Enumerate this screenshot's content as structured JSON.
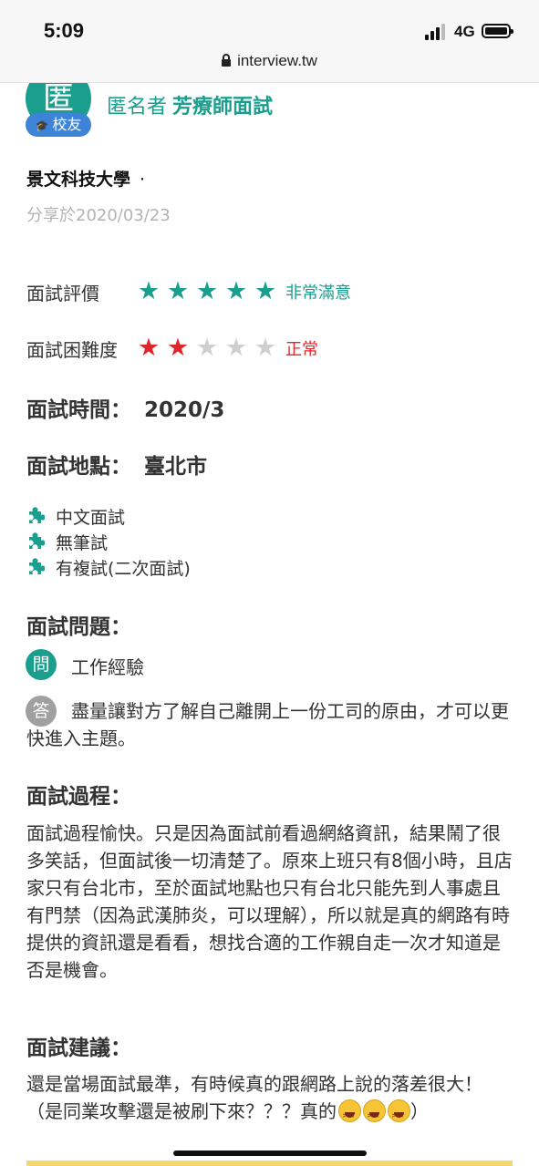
{
  "status_bar": {
    "time": "5:09",
    "network": "4G",
    "url": "interview.tw"
  },
  "author": {
    "avatar_char": "匿",
    "badge": "校友",
    "name": "匿名者",
    "job_title": "芳療師面試",
    "school": "景文科技大學",
    "school_separator": "·",
    "shared_on": "分享於2020/03/23"
  },
  "ratings": {
    "evaluation": {
      "label": "面試評價",
      "stars": 5,
      "max": 5,
      "text": "非常滿意",
      "color": "#1a9e8d"
    },
    "difficulty": {
      "label": "面試困難度",
      "stars": 2,
      "max": 5,
      "text": "正常",
      "color": "#e0252b"
    }
  },
  "details": {
    "time_label": "面試時間：",
    "time_value": "2020/3",
    "place_label": "面試地點：",
    "place_value": "臺北市"
  },
  "tags": [
    "中文面試",
    "無筆試",
    "有複試(二次面試)"
  ],
  "questions": {
    "title": "面試問題：",
    "q_badge": "問",
    "question": "工作經驗",
    "a_badge": "答",
    "answer": "盡量讓對方了解自己離開上一份工司的原由，才可以更快進入主題。"
  },
  "process": {
    "title": "面試過程：",
    "text": "面試過程愉快。只是因為面試前看過網絡資訊，結果鬧了很多笑話，但面試後一切清楚了。原來上班只有8個小時，且店家只有台北市，至於面試地點也只有台北只能先到人事處且有門禁（因為武漢肺炎，可以理解），所以就是真的網路有時提供的資訊還是看看，想找合適的工作親自走一次才知道是否是機會。"
  },
  "advice": {
    "title": "面試建議：",
    "text_before": "還是當場面試最準，有時候真的跟網路上說的落差很大！（是同業攻擊還是被刷下來？？？真的",
    "text_after": "）",
    "emoji_name": "grinning-squinting-face"
  },
  "colors": {
    "accent": "#1a9e8d",
    "alumni": "#3d84d8",
    "danger": "#e0252b"
  }
}
